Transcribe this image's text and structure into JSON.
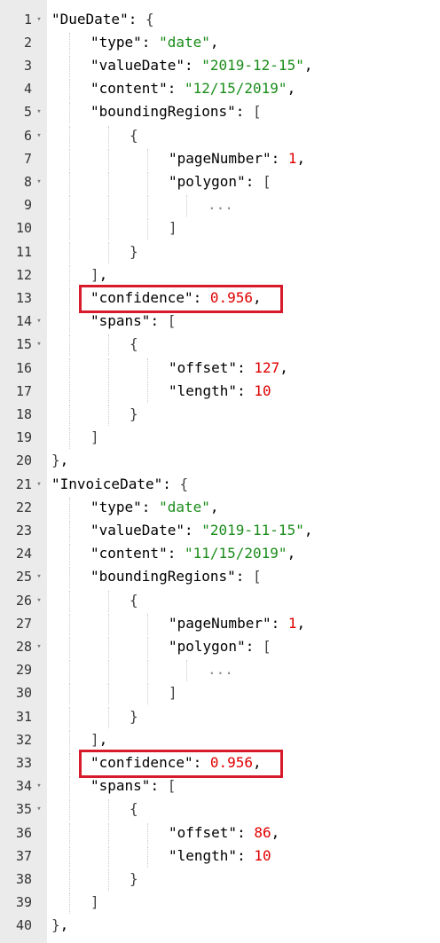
{
  "editor": {
    "highlight_color": "#d81b2a",
    "colors": {
      "string": "#1a8c1a",
      "number": "#e00000",
      "key": "#000000",
      "gutter": "#ebebeb"
    },
    "lines": [
      {
        "num": "1",
        "fold": true,
        "indent": 0,
        "tokens": [
          {
            "t": "key",
            "v": "\"DueDate\""
          },
          {
            "t": "punc",
            "v": ": "
          },
          {
            "t": "bracket",
            "v": "{"
          }
        ]
      },
      {
        "num": "2",
        "fold": false,
        "indent": 1,
        "tokens": [
          {
            "t": "key",
            "v": "\"type\""
          },
          {
            "t": "punc",
            "v": ": "
          },
          {
            "t": "str",
            "v": "\"date\""
          },
          {
            "t": "punc",
            "v": ","
          }
        ]
      },
      {
        "num": "3",
        "fold": false,
        "indent": 1,
        "tokens": [
          {
            "t": "key",
            "v": "\"valueDate\""
          },
          {
            "t": "punc",
            "v": ": "
          },
          {
            "t": "str",
            "v": "\"2019-12-15\""
          },
          {
            "t": "punc",
            "v": ","
          }
        ]
      },
      {
        "num": "4",
        "fold": false,
        "indent": 1,
        "tokens": [
          {
            "t": "key",
            "v": "\"content\""
          },
          {
            "t": "punc",
            "v": ": "
          },
          {
            "t": "str",
            "v": "\"12/15/2019\""
          },
          {
            "t": "punc",
            "v": ","
          }
        ]
      },
      {
        "num": "5",
        "fold": true,
        "indent": 1,
        "tokens": [
          {
            "t": "key",
            "v": "\"boundingRegions\""
          },
          {
            "t": "punc",
            "v": ": "
          },
          {
            "t": "bracket",
            "v": "["
          }
        ]
      },
      {
        "num": "6",
        "fold": true,
        "indent": 2,
        "tokens": [
          {
            "t": "bracket",
            "v": "{"
          }
        ]
      },
      {
        "num": "7",
        "fold": false,
        "indent": 3,
        "tokens": [
          {
            "t": "key",
            "v": "\"pageNumber\""
          },
          {
            "t": "punc",
            "v": ": "
          },
          {
            "t": "num",
            "v": "1"
          },
          {
            "t": "punc",
            "v": ","
          }
        ]
      },
      {
        "num": "8",
        "fold": true,
        "indent": 3,
        "tokens": [
          {
            "t": "key",
            "v": "\"polygon\""
          },
          {
            "t": "punc",
            "v": ": "
          },
          {
            "t": "bracket",
            "v": "["
          }
        ]
      },
      {
        "num": "9",
        "fold": false,
        "indent": 4,
        "tokens": [
          {
            "t": "dim",
            "v": "..."
          }
        ]
      },
      {
        "num": "10",
        "fold": false,
        "indent": 3,
        "tokens": [
          {
            "t": "bracket",
            "v": "]"
          }
        ]
      },
      {
        "num": "11",
        "fold": false,
        "indent": 2,
        "tokens": [
          {
            "t": "bracket",
            "v": "}"
          }
        ]
      },
      {
        "num": "12",
        "fold": false,
        "indent": 1,
        "tokens": [
          {
            "t": "bracket",
            "v": "]"
          },
          {
            "t": "punc",
            "v": ","
          }
        ]
      },
      {
        "num": "13",
        "fold": false,
        "indent": 1,
        "highlight": true,
        "tokens": [
          {
            "t": "key",
            "v": "\"confidence\""
          },
          {
            "t": "punc",
            "v": ": "
          },
          {
            "t": "num",
            "v": "0.956"
          },
          {
            "t": "punc",
            "v": ","
          }
        ]
      },
      {
        "num": "14",
        "fold": true,
        "indent": 1,
        "tokens": [
          {
            "t": "key",
            "v": "\"spans\""
          },
          {
            "t": "punc",
            "v": ": "
          },
          {
            "t": "bracket",
            "v": "["
          }
        ]
      },
      {
        "num": "15",
        "fold": true,
        "indent": 2,
        "tokens": [
          {
            "t": "bracket",
            "v": "{"
          }
        ]
      },
      {
        "num": "16",
        "fold": false,
        "indent": 3,
        "tokens": [
          {
            "t": "key",
            "v": "\"offset\""
          },
          {
            "t": "punc",
            "v": ": "
          },
          {
            "t": "num",
            "v": "127"
          },
          {
            "t": "punc",
            "v": ","
          }
        ]
      },
      {
        "num": "17",
        "fold": false,
        "indent": 3,
        "tokens": [
          {
            "t": "key",
            "v": "\"length\""
          },
          {
            "t": "punc",
            "v": ": "
          },
          {
            "t": "num",
            "v": "10"
          }
        ]
      },
      {
        "num": "18",
        "fold": false,
        "indent": 2,
        "tokens": [
          {
            "t": "bracket",
            "v": "}"
          }
        ]
      },
      {
        "num": "19",
        "fold": false,
        "indent": 1,
        "tokens": [
          {
            "t": "bracket",
            "v": "]"
          }
        ]
      },
      {
        "num": "20",
        "fold": false,
        "indent": 0,
        "tokens": [
          {
            "t": "bracket",
            "v": "}"
          },
          {
            "t": "punc",
            "v": ","
          }
        ]
      },
      {
        "num": "21",
        "fold": true,
        "indent": 0,
        "tokens": [
          {
            "t": "key",
            "v": "\"InvoiceDate\""
          },
          {
            "t": "punc",
            "v": ": "
          },
          {
            "t": "bracket",
            "v": "{"
          }
        ]
      },
      {
        "num": "22",
        "fold": false,
        "indent": 1,
        "tokens": [
          {
            "t": "key",
            "v": "\"type\""
          },
          {
            "t": "punc",
            "v": ": "
          },
          {
            "t": "str",
            "v": "\"date\""
          },
          {
            "t": "punc",
            "v": ","
          }
        ]
      },
      {
        "num": "23",
        "fold": false,
        "indent": 1,
        "tokens": [
          {
            "t": "key",
            "v": "\"valueDate\""
          },
          {
            "t": "punc",
            "v": ": "
          },
          {
            "t": "str",
            "v": "\"2019-11-15\""
          },
          {
            "t": "punc",
            "v": ","
          }
        ]
      },
      {
        "num": "24",
        "fold": false,
        "indent": 1,
        "tokens": [
          {
            "t": "key",
            "v": "\"content\""
          },
          {
            "t": "punc",
            "v": ": "
          },
          {
            "t": "str",
            "v": "\"11/15/2019\""
          },
          {
            "t": "punc",
            "v": ","
          }
        ]
      },
      {
        "num": "25",
        "fold": true,
        "indent": 1,
        "tokens": [
          {
            "t": "key",
            "v": "\"boundingRegions\""
          },
          {
            "t": "punc",
            "v": ": "
          },
          {
            "t": "bracket",
            "v": "["
          }
        ]
      },
      {
        "num": "26",
        "fold": true,
        "indent": 2,
        "tokens": [
          {
            "t": "bracket",
            "v": "{"
          }
        ]
      },
      {
        "num": "27",
        "fold": false,
        "indent": 3,
        "tokens": [
          {
            "t": "key",
            "v": "\"pageNumber\""
          },
          {
            "t": "punc",
            "v": ": "
          },
          {
            "t": "num",
            "v": "1"
          },
          {
            "t": "punc",
            "v": ","
          }
        ]
      },
      {
        "num": "28",
        "fold": true,
        "indent": 3,
        "tokens": [
          {
            "t": "key",
            "v": "\"polygon\""
          },
          {
            "t": "punc",
            "v": ": "
          },
          {
            "t": "bracket",
            "v": "["
          }
        ]
      },
      {
        "num": "29",
        "fold": false,
        "indent": 4,
        "tokens": [
          {
            "t": "dim",
            "v": "..."
          }
        ]
      },
      {
        "num": "30",
        "fold": false,
        "indent": 3,
        "tokens": [
          {
            "t": "bracket",
            "v": "]"
          }
        ]
      },
      {
        "num": "31",
        "fold": false,
        "indent": 2,
        "tokens": [
          {
            "t": "bracket",
            "v": "}"
          }
        ]
      },
      {
        "num": "32",
        "fold": false,
        "indent": 1,
        "tokens": [
          {
            "t": "bracket",
            "v": "]"
          },
          {
            "t": "punc",
            "v": ","
          }
        ]
      },
      {
        "num": "33",
        "fold": false,
        "indent": 1,
        "highlight": true,
        "tokens": [
          {
            "t": "key",
            "v": "\"confidence\""
          },
          {
            "t": "punc",
            "v": ": "
          },
          {
            "t": "num",
            "v": "0.956"
          },
          {
            "t": "punc",
            "v": ","
          }
        ]
      },
      {
        "num": "34",
        "fold": true,
        "indent": 1,
        "tokens": [
          {
            "t": "key",
            "v": "\"spans\""
          },
          {
            "t": "punc",
            "v": ": "
          },
          {
            "t": "bracket",
            "v": "["
          }
        ]
      },
      {
        "num": "35",
        "fold": true,
        "indent": 2,
        "tokens": [
          {
            "t": "bracket",
            "v": "{"
          }
        ]
      },
      {
        "num": "36",
        "fold": false,
        "indent": 3,
        "tokens": [
          {
            "t": "key",
            "v": "\"offset\""
          },
          {
            "t": "punc",
            "v": ": "
          },
          {
            "t": "num",
            "v": "86"
          },
          {
            "t": "punc",
            "v": ","
          }
        ]
      },
      {
        "num": "37",
        "fold": false,
        "indent": 3,
        "tokens": [
          {
            "t": "key",
            "v": "\"length\""
          },
          {
            "t": "punc",
            "v": ": "
          },
          {
            "t": "num",
            "v": "10"
          }
        ]
      },
      {
        "num": "38",
        "fold": false,
        "indent": 2,
        "tokens": [
          {
            "t": "bracket",
            "v": "}"
          }
        ]
      },
      {
        "num": "39",
        "fold": false,
        "indent": 1,
        "tokens": [
          {
            "t": "bracket",
            "v": "]"
          }
        ]
      },
      {
        "num": "40",
        "fold": false,
        "indent": 0,
        "tokens": [
          {
            "t": "bracket",
            "v": "}"
          },
          {
            "t": "punc",
            "v": ","
          }
        ]
      }
    ]
  }
}
